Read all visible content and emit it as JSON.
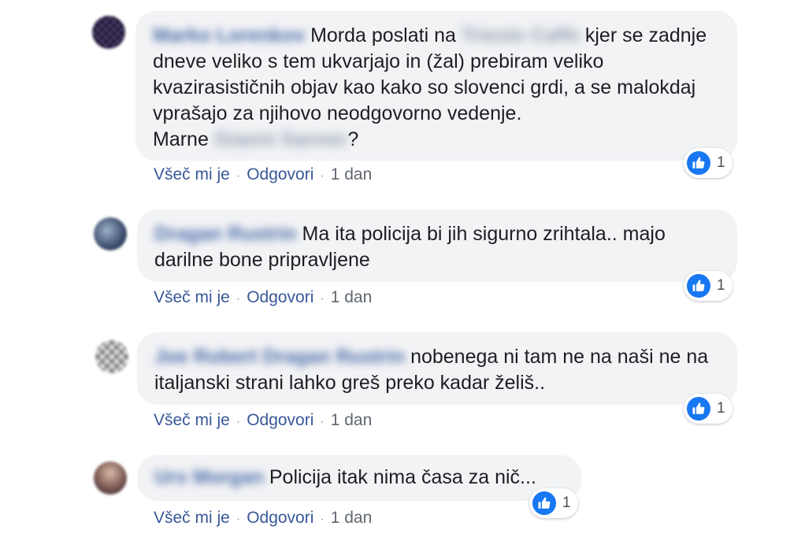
{
  "comments": [
    {
      "author": "Marko Lorenkov",
      "text_before": "Morda poslati na",
      "mention1": "Trieste Caffe",
      "text_after": "kjer se zadnje dneve veliko s tem ukvarjajo in (žal) prebiram veliko kvazirasističnih objav kao kako so slovenci grdi, a se malokdaj vprašajo za njihovo neodgovorno vedenje.",
      "text_marne": "Marne",
      "mention2": "Gianni Sanner",
      "text_end": "?",
      "like_label": "Všeč mi je",
      "reply_label": "Odgovori",
      "time": "1 dan",
      "reaction_count": "1"
    },
    {
      "author": "Dragan Rustrin",
      "text": "Ma ita policija bi jih sigurno zrihtala.. majo darilne bone pripravljene",
      "like_label": "Všeč mi je",
      "reply_label": "Odgovori",
      "time": "1 dan",
      "reaction_count": "1"
    },
    {
      "author": "Joe Robert Dragan Rustrin",
      "text": "nobenega ni tam ne na naši ne na italjanski strani lahko greš preko kadar želiš..",
      "like_label": "Všeč mi je",
      "reply_label": "Odgovori",
      "time": "1 dan",
      "reaction_count": "1"
    },
    {
      "author": "Urs Morgan",
      "text": "Policija itak nima časa za nič...",
      "like_label": "Všeč mi je",
      "reply_label": "Odgovori",
      "time": "1 dan",
      "reaction_count": "1"
    }
  ],
  "colors": {
    "bubble_bg": "#f2f3f5",
    "link": "#385898",
    "like_blue": "#1877f2"
  },
  "icons": {
    "reaction": "thumbs-up-icon"
  }
}
